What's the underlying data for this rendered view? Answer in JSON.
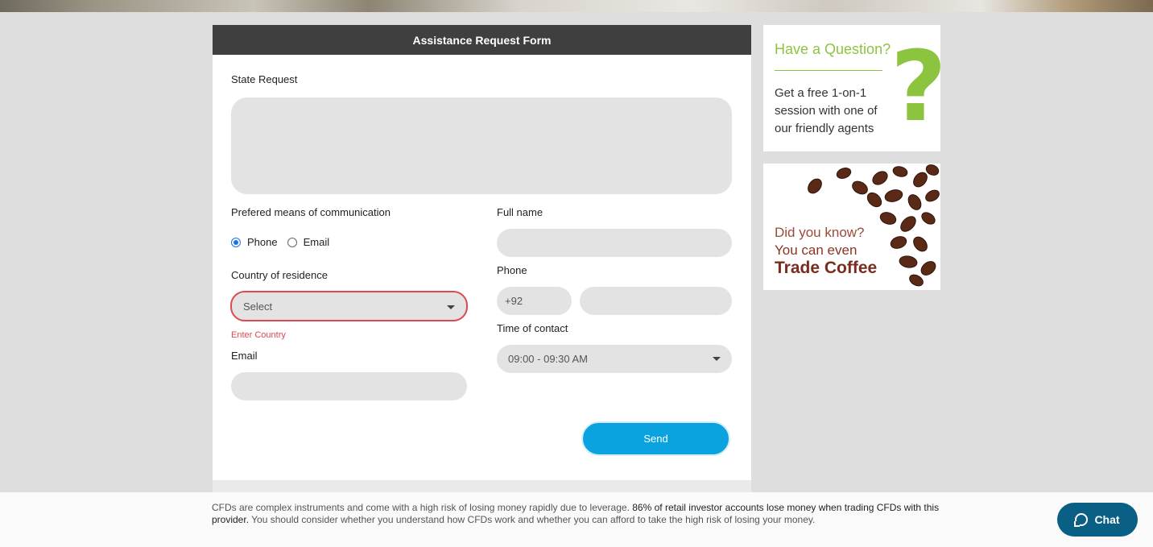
{
  "form": {
    "title": "Assistance Request Form",
    "state_request_label": "State Request",
    "communication_label": "Prefered means of communication",
    "radio_phone": "Phone",
    "radio_email": "Email",
    "country_label": "Country of residence",
    "country_value": "Select",
    "country_error": "Enter Country",
    "email_label": "Email",
    "fullname_label": "Full name",
    "phone_label": "Phone",
    "phone_prefix": "+92",
    "time_label": "Time of contact",
    "time_value": "09:00 - 09:30 AM",
    "send_label": "Send"
  },
  "ads": {
    "question_title": "Have a Question?",
    "question_body": "Get a free 1-on-1 session with one of our friendly agents",
    "question_mark": "?",
    "coffee_line1": "Did you know?",
    "coffee_line2": "You can even",
    "coffee_line3": "Trade Coffee"
  },
  "footer": {
    "risk_part1": "CFDs are complex instruments and come with a high risk of losing money rapidly due to leverage. ",
    "risk_bold": "86% of retail investor accounts lose money when trading CFDs with this provider.",
    "risk_part2": " You should consider whether you understand how CFDs work and whether you can afford to take the high risk of losing your money.",
    "chat_label": "Chat"
  },
  "colors": {
    "accent": "#0aa3e0",
    "error": "#e04850",
    "ad_green": "#8dc43f",
    "chat": "#0a5f85"
  }
}
